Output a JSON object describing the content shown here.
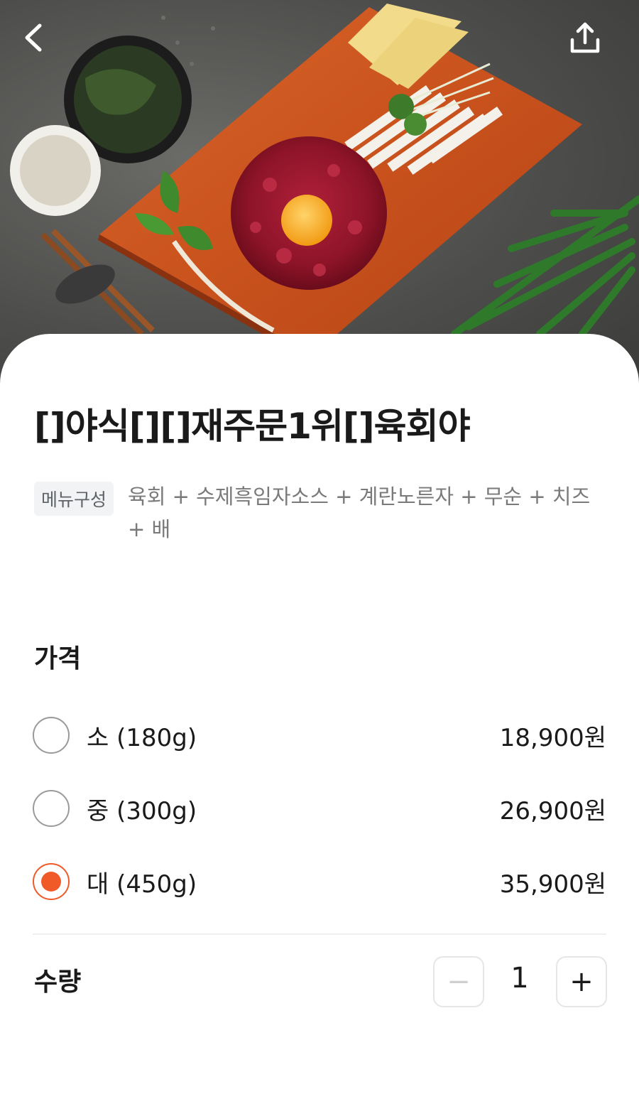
{
  "hero": {
    "image_desc_icon": "food-photo-icon",
    "back_icon": "chevron-left-icon",
    "share_icon": "share-upload-icon"
  },
  "product": {
    "title": "[]야식[][]재주문1위[]육회야",
    "composition_label": "메뉴구성",
    "composition": "육회 + 수제흑임자소스 + 계란노른자 + 무순 + 치즈 + 배"
  },
  "price_section": {
    "label": "가격",
    "options": [
      {
        "name": "소 (180g)",
        "price": "18,900원",
        "selected": false
      },
      {
        "name": "중 (300g)",
        "price": "26,900원",
        "selected": false
      },
      {
        "name": "대 (450g)",
        "price": "35,900원",
        "selected": true
      }
    ]
  },
  "quantity_section": {
    "label": "수량",
    "value": "1",
    "minus_label": "−",
    "plus_label": "+"
  },
  "colors": {
    "accent": "#f05a28",
    "text": "#1a1a1a",
    "muted": "#7a7a7a"
  }
}
